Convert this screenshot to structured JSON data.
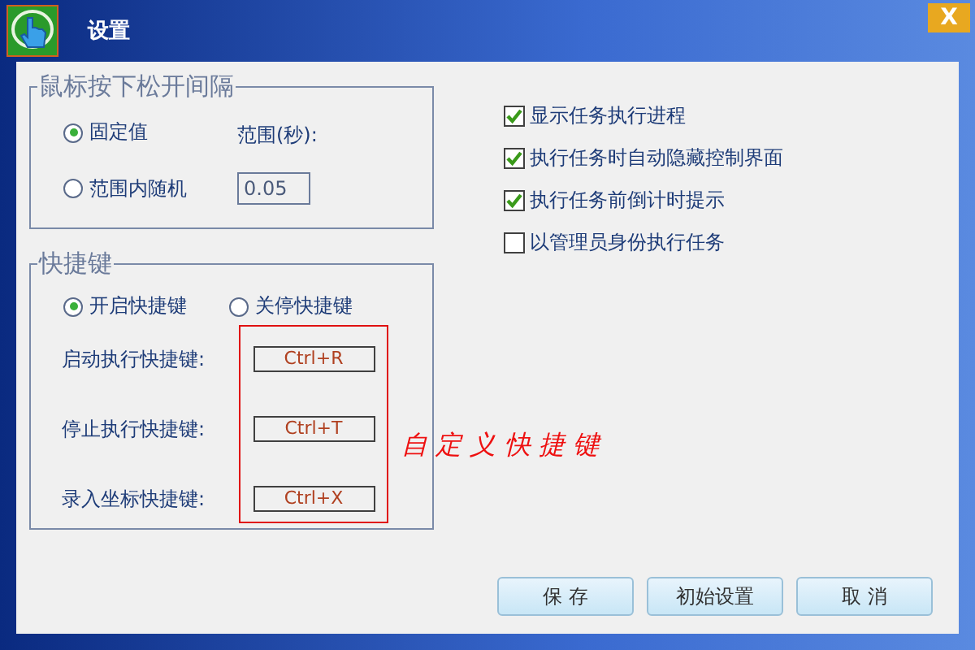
{
  "window": {
    "title": "设置",
    "close": "X"
  },
  "interval_group": {
    "title": "鼠标按下松开间隔",
    "options": [
      {
        "label": "固定值",
        "selected": true
      },
      {
        "label": "范围内随机",
        "selected": false
      }
    ],
    "range_label": "范围(秒):",
    "range_value": "0.05"
  },
  "hotkey_group": {
    "title": "快捷键",
    "options": [
      {
        "label": "开启快捷键",
        "selected": true
      },
      {
        "label": "关停快捷键",
        "selected": false
      }
    ],
    "hotkeys": [
      {
        "label": "启动执行快捷键:",
        "value": "Ctrl+R"
      },
      {
        "label": "停止执行快捷键:",
        "value": "Ctrl+T"
      },
      {
        "label": "录入坐标快捷键:",
        "value": "Ctrl+X"
      }
    ],
    "annotation": "自 定 义 快 捷 键"
  },
  "checkboxes": [
    {
      "label": "显示任务执行进程",
      "checked": true
    },
    {
      "label": "执行任务时自动隐藏控制界面",
      "checked": true
    },
    {
      "label": "执行任务前倒计时提示",
      "checked": true
    },
    {
      "label": "以管理员身份执行任务",
      "checked": false
    }
  ],
  "buttons": [
    "保 存",
    "初始设置",
    "取 消"
  ]
}
